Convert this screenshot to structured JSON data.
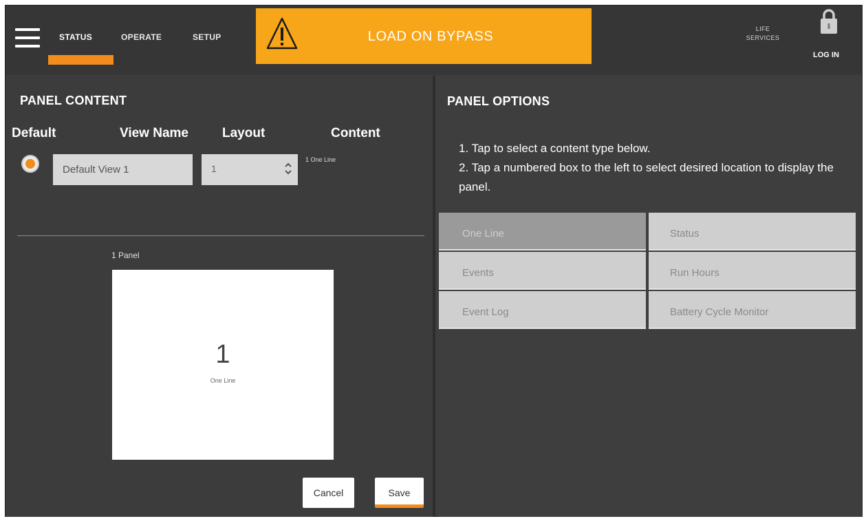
{
  "nav": {
    "tabs": [
      "STATUS",
      "OPERATE",
      "SETUP"
    ],
    "active_tab": "STATUS",
    "menu_icon": "hamburger-menu-icon"
  },
  "alarm": {
    "text": "LOAD ON BYPASS",
    "icon": "warning-triangle-icon",
    "color": "#f7a519"
  },
  "header_right": {
    "life_services_line1": "LIFE",
    "life_services_line2": "SERVICES",
    "login_label": "LOG IN",
    "lock_icon": "lock-icon"
  },
  "panel_content": {
    "title": "PANEL CONTENT",
    "columns": {
      "default": "Default",
      "view_name": "View Name",
      "layout": "Layout",
      "content": "Content"
    },
    "row": {
      "view_name": "Default View 1",
      "layout": "1",
      "content": "1 One Line"
    },
    "preview_label": "1 Panel",
    "preview_number": "1",
    "preview_content": "One Line",
    "cancel_label": "Cancel",
    "save_label": "Save"
  },
  "panel_options": {
    "title": "PANEL OPTIONS",
    "instruction_1": "1. Tap to select a content type below.",
    "instruction_2": "2. Tap a numbered box to the left to select desired location to display the panel.",
    "options": [
      "One Line",
      "Status",
      "Events",
      "Run Hours",
      "Event Log",
      "Battery Cycle Monitor"
    ],
    "selected": "One Line"
  },
  "colors": {
    "accent": "#f28c1c",
    "banner": "#f7a519",
    "background": "#3e3e3e"
  }
}
